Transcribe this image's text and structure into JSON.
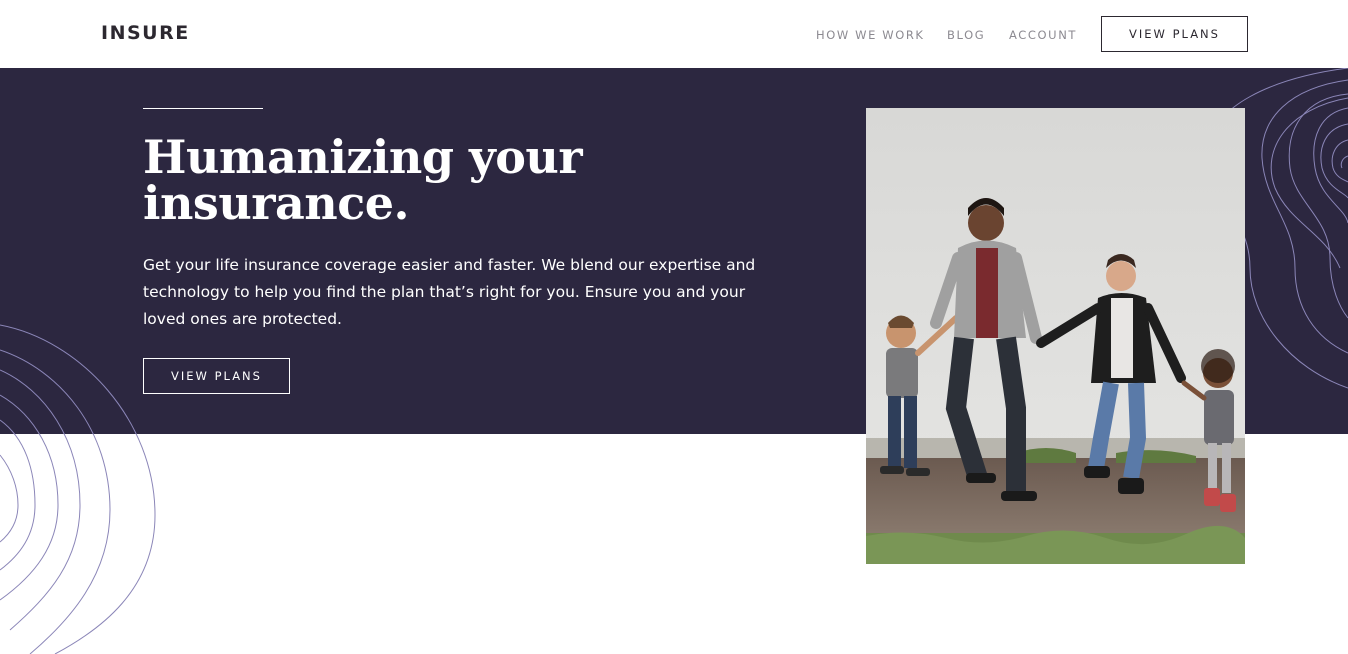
{
  "header": {
    "logo": "INSURE",
    "nav": [
      {
        "label": "HOW WE WORK"
      },
      {
        "label": "BLOG"
      },
      {
        "label": "ACCOUNT"
      }
    ],
    "cta_label": "VIEW PLANS"
  },
  "hero": {
    "title": "Humanizing your insurance.",
    "description": "Get your life insurance coverage easier and faster. We blend our expertise and technology to help you find the plan that’s right for you. Ensure you and your loved ones are protected.",
    "cta_label": "VIEW PLANS"
  },
  "colors": {
    "hero_background": "#2c2740",
    "pattern_stroke": "#8b86b8",
    "text_dark": "#2c2830",
    "nav_text": "#8c8a91"
  },
  "icons": {
    "pattern_right": "curved-lines-pattern",
    "pattern_left": "curved-lines-pattern"
  }
}
